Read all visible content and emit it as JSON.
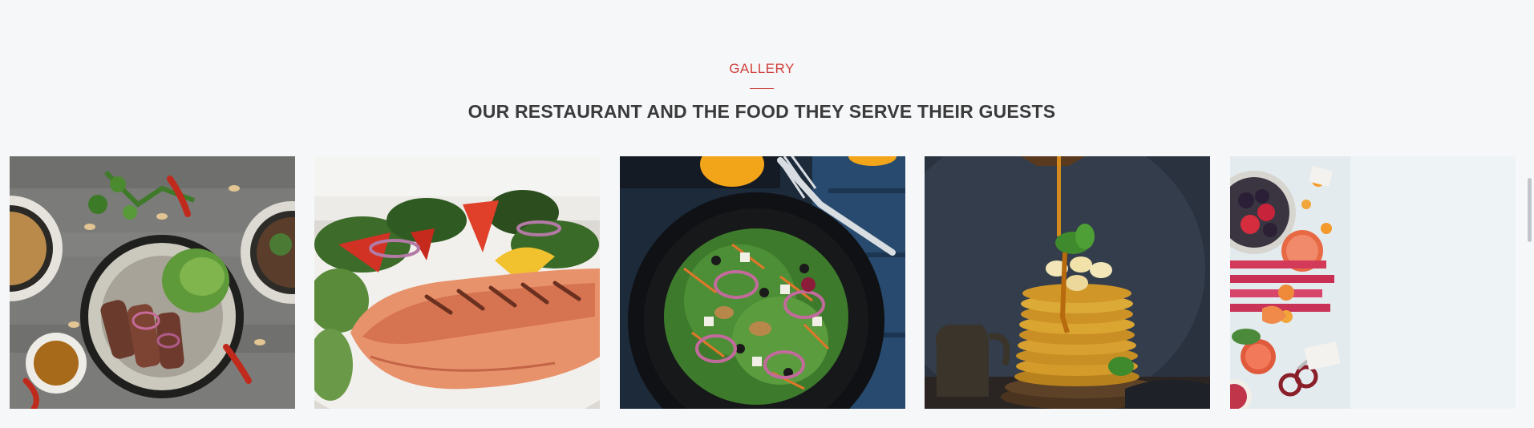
{
  "section": {
    "eyebrow": "GALLERY",
    "title": "OUR RESTAURANT AND THE FOOD THEY SERVE THEIR GUESTS"
  },
  "colors": {
    "accent": "#d0403a",
    "title": "#3a3a3a",
    "background": "#f6f7f9"
  },
  "gallery": {
    "items": [
      {
        "image": "steak-with-herbs-and-sauce-image"
      },
      {
        "image": "grilled-salmon-salad-image"
      },
      {
        "image": "green-salad-on-dark-plate-image"
      },
      {
        "image": "pancake-stack-with-syrup-image"
      },
      {
        "image": "berries-and-fruit-flatlay-image"
      }
    ]
  }
}
